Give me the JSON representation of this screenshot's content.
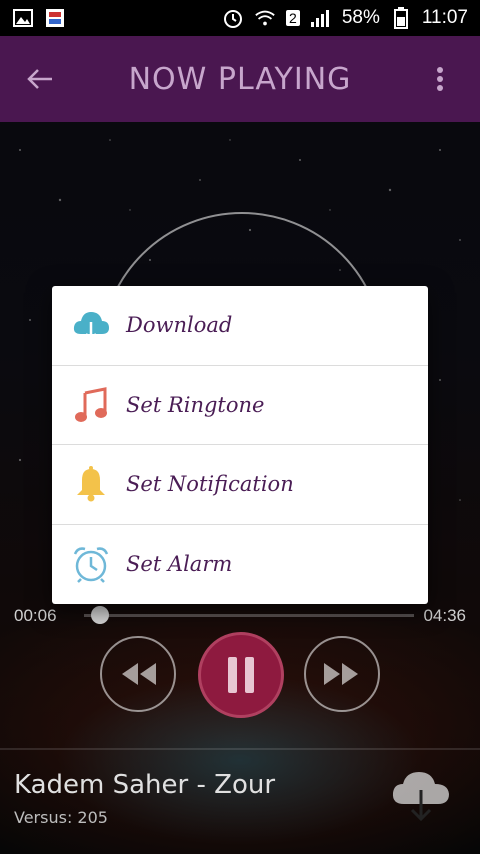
{
  "status_bar": {
    "sim_badge": "2",
    "battery_percent": "58%",
    "time": "11:07"
  },
  "app_bar": {
    "title": "NOW PLAYING"
  },
  "player": {
    "time_current": "00:06",
    "time_total": "04:36",
    "progress_fraction": 0.02,
    "track_title": "Kadem Saher - Zour",
    "track_subtitle": "Versus: 205"
  },
  "dialog": {
    "items": [
      {
        "label": "Download",
        "icon": "cloud-download-icon"
      },
      {
        "label": "Set Ringtone",
        "icon": "music-note-icon"
      },
      {
        "label": "Set Notification",
        "icon": "bell-icon"
      },
      {
        "label": "Set Alarm",
        "icon": "alarm-clock-icon"
      }
    ]
  },
  "colors": {
    "app_bar": "#4a1750",
    "accent": "#8e1a3f",
    "menu_text": "#4a1d55"
  }
}
